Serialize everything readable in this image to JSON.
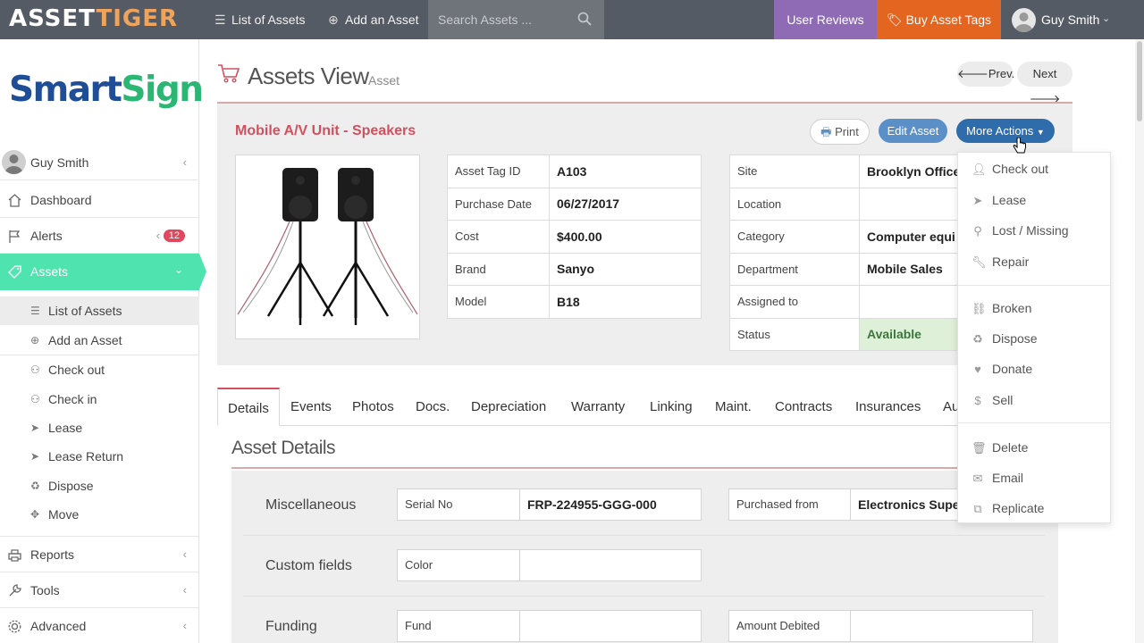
{
  "topbar": {
    "logo_part1": "ASSET",
    "logo_part2": "TIGER",
    "list_assets": "List of Assets",
    "add_asset": "Add an Asset",
    "search_placeholder": "Search Assets ...",
    "user_reviews": "User Reviews",
    "buy_tags": "Buy Asset Tags",
    "user_name": "Guy Smith"
  },
  "sidebar": {
    "brand_part1": "Smart",
    "brand_part2": "Sign",
    "user_name": "Guy Smith",
    "items": [
      {
        "label": "Dashboard",
        "icon": "home-icon"
      },
      {
        "label": "Alerts",
        "icon": "flag-icon",
        "badge": "12"
      },
      {
        "label": "Assets",
        "icon": "tag-icon"
      },
      {
        "label": "Reports",
        "icon": "printer-icon"
      },
      {
        "label": "Tools",
        "icon": "wrench-icon"
      },
      {
        "label": "Advanced",
        "icon": "gear-icon"
      }
    ],
    "asset_sub": [
      "List of Assets",
      "Add an Asset"
    ],
    "asset_actions": [
      "Check out",
      "Check in",
      "Lease",
      "Lease Return",
      "Dispose",
      "Move"
    ]
  },
  "main": {
    "title": "Assets View",
    "subtitle": "Asset",
    "prev": "Prev.",
    "next": "Next",
    "asset_name": "Mobile A/V Unit - Speakers",
    "print": "Print",
    "edit": "Edit Asset",
    "more": "More Actions",
    "left_table": [
      {
        "k": "Asset Tag ID",
        "v": "A103"
      },
      {
        "k": "Purchase Date",
        "v": "06/27/2017"
      },
      {
        "k": "Cost",
        "v": "$400.00"
      },
      {
        "k": "Brand",
        "v": "Sanyo"
      },
      {
        "k": "Model",
        "v": "B18"
      }
    ],
    "right_table": [
      {
        "k": "Site",
        "v": "Brooklyn Office"
      },
      {
        "k": "Location",
        "v": ""
      },
      {
        "k": "Category",
        "v": "Computer equi"
      },
      {
        "k": "Department",
        "v": "Mobile Sales"
      },
      {
        "k": "Assigned to",
        "v": ""
      },
      {
        "k": "Status",
        "v": "Available"
      }
    ],
    "tabs": [
      "Details",
      "Events",
      "Photos",
      "Docs.",
      "Depreciation",
      "Warranty",
      "Linking",
      "Maint.",
      "Contracts",
      "Insurances",
      "Au"
    ],
    "section_title": "Asset Details",
    "rows": [
      {
        "label": "Miscellaneous",
        "f1k": "Serial No",
        "f1v": "FRP-224955-GGG-000",
        "f2k": "Purchased from",
        "f2v": "Electronics Super"
      },
      {
        "label": "Custom fields",
        "f1k": "Color",
        "f1v": ""
      },
      {
        "label": "Funding",
        "f1k": "Fund",
        "f1v": "",
        "f2k": "Amount Debited",
        "f2v": ""
      }
    ]
  },
  "dropdown": {
    "group1": [
      "Check out",
      "Lease",
      "Lost / Missing",
      "Repair"
    ],
    "group2": [
      "Broken",
      "Dispose",
      "Donate",
      "Sell"
    ],
    "group3": [
      "Delete",
      "Email",
      "Replicate"
    ]
  }
}
